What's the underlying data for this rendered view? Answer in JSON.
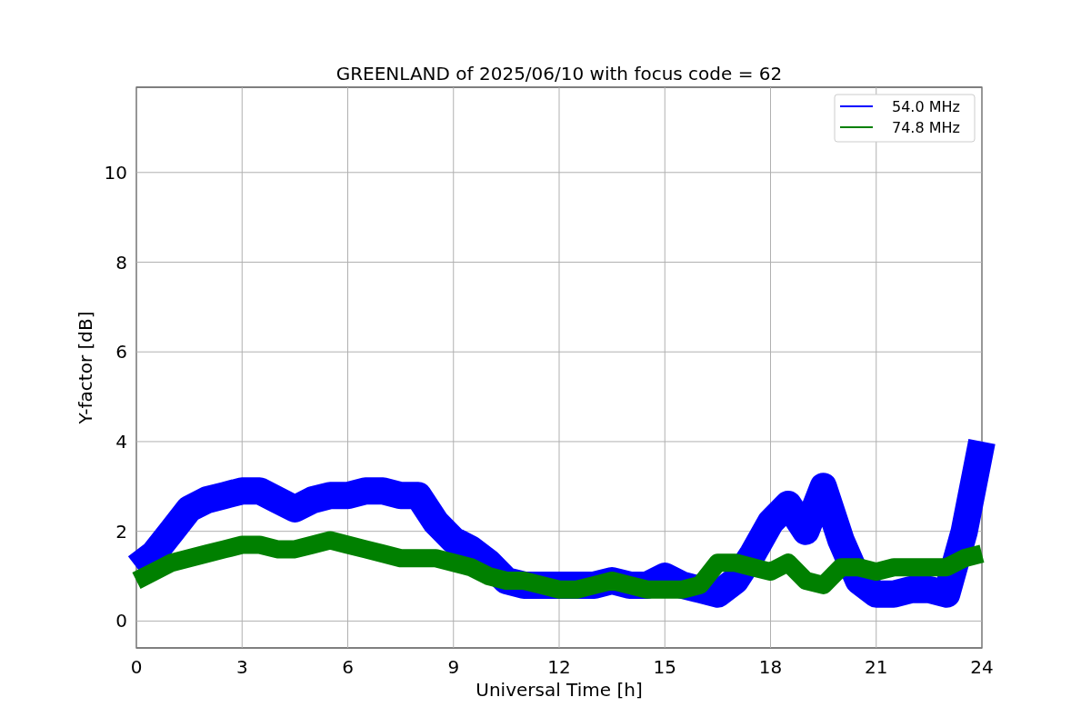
{
  "figure": {
    "chart_data": {
      "type": "line",
      "title": "GREENLAND of 2025/06/10 with focus code = 62",
      "xlabel": "Universal Time [h]",
      "ylabel": "Y-factor [dB]",
      "x": [
        0,
        0.5,
        1,
        1.5,
        2,
        2.5,
        3,
        3.5,
        4,
        4.5,
        5,
        5.5,
        6,
        6.5,
        7,
        7.5,
        8,
        8.5,
        9,
        9.5,
        10,
        10.5,
        11,
        11.5,
        12,
        12.5,
        13,
        13.5,
        14,
        14.5,
        15,
        15.5,
        16,
        16.5,
        17,
        17.5,
        18,
        18.5,
        19,
        19.5,
        20,
        20.5,
        21,
        21.5,
        22,
        22.5,
        23,
        23.5,
        24
      ],
      "series": [
        {
          "name": "54.0 MHz",
          "color": "#0000ff",
          "values": [
            1.2,
            1.5,
            2.0,
            2.5,
            2.7,
            2.8,
            2.9,
            2.9,
            2.7,
            2.5,
            2.7,
            2.8,
            2.8,
            2.9,
            2.9,
            2.8,
            2.8,
            2.2,
            1.8,
            1.6,
            1.3,
            0.9,
            0.8,
            0.8,
            0.8,
            0.8,
            0.8,
            0.9,
            0.8,
            0.8,
            1.0,
            0.8,
            0.7,
            0.6,
            0.9,
            1.5,
            2.2,
            2.6,
            2.0,
            3.0,
            1.8,
            0.9,
            0.6,
            0.6,
            0.7,
            0.7,
            0.6,
            2.0,
            4.0
          ]
        },
        {
          "name": "74.8 MHz",
          "color": "#008000",
          "values": [
            0.9,
            1.1,
            1.3,
            1.4,
            1.5,
            1.6,
            1.7,
            1.7,
            1.6,
            1.6,
            1.7,
            1.8,
            1.7,
            1.6,
            1.5,
            1.4,
            1.4,
            1.4,
            1.3,
            1.2,
            1.0,
            0.9,
            0.9,
            0.8,
            0.7,
            0.7,
            0.8,
            0.9,
            0.8,
            0.7,
            0.7,
            0.7,
            0.8,
            1.3,
            1.3,
            1.2,
            1.1,
            1.3,
            0.9,
            0.8,
            1.2,
            1.2,
            1.1,
            1.2,
            1.2,
            1.2,
            1.2,
            1.4,
            1.5
          ]
        }
      ],
      "grid": true,
      "legend": true,
      "xlim": [
        0,
        24
      ],
      "ylim": [
        -0.6,
        11.9
      ],
      "xticks": [
        0,
        3,
        6,
        9,
        12,
        15,
        18,
        21,
        24
      ],
      "yticks": [
        0,
        2,
        4,
        6,
        8,
        10
      ]
    }
  }
}
